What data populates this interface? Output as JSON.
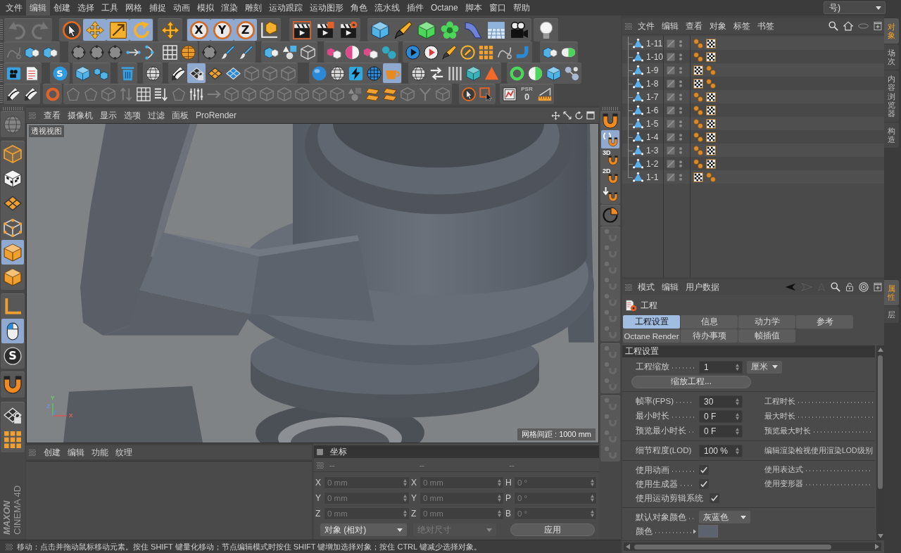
{
  "menu_bar": {
    "items": [
      {
        "label": "文件",
        "selected": false
      },
      {
        "label": "编辑",
        "selected": true
      },
      {
        "label": "创建",
        "selected": false
      },
      {
        "label": "选择",
        "selected": false
      },
      {
        "label": "工具",
        "selected": false
      },
      {
        "label": "网格",
        "selected": false
      },
      {
        "label": "捕捉",
        "selected": false
      },
      {
        "label": "动画",
        "selected": false
      },
      {
        "label": "模拟",
        "selected": false
      },
      {
        "label": "渲染",
        "selected": false
      },
      {
        "label": "雕刻",
        "selected": false
      },
      {
        "label": "运动跟踪",
        "selected": false
      },
      {
        "label": "运动图形",
        "selected": false
      },
      {
        "label": "角色",
        "selected": false
      },
      {
        "label": "流水线",
        "selected": false
      },
      {
        "label": "插件",
        "selected": false
      },
      {
        "label": "Octane",
        "selected": false
      },
      {
        "label": "脚本",
        "selected": false
      },
      {
        "label": "窗口",
        "selected": false
      },
      {
        "label": "帮助",
        "selected": false
      }
    ],
    "layout_dropdown": {
      "value": "号)"
    }
  },
  "toolbar": {
    "rows": [
      [
        {
          "buttons": [
            {
              "selected": false,
              "disabled": true
            },
            {
              "selected": false,
              "disabled": true
            }
          ]
        },
        {
          "buttons": [
            {
              "selected": false,
              "disabled": false
            },
            {
              "selected": true,
              "disabled": false
            },
            {
              "selected": true,
              "disabled": false
            },
            {
              "selected": true,
              "disabled": false
            }
          ]
        },
        {
          "buttons": [
            {
              "selected": false,
              "disabled": false
            }
          ]
        },
        {
          "buttons": [
            {
              "label": "X",
              "selected": true,
              "disabled": false
            },
            {
              "label": "Y",
              "selected": true,
              "disabled": false
            },
            {
              "label": "Z",
              "selected": true,
              "disabled": false
            },
            {
              "selected": false,
              "disabled": false
            }
          ]
        },
        {
          "buttons": [
            {
              "selected": false,
              "disabled": false
            },
            {
              "selected": false,
              "disabled": false
            },
            {
              "selected": false,
              "disabled": false
            }
          ]
        },
        {
          "buttons": [
            {
              "selected": false,
              "disabled": false
            },
            {
              "selected": false,
              "disabled": false
            },
            {
              "selected": false,
              "disabled": false
            },
            {
              "selected": false,
              "disabled": false
            },
            {
              "selected": false,
              "disabled": false
            },
            {
              "selected": false,
              "disabled": false
            },
            {
              "selected": false,
              "disabled": false
            }
          ]
        },
        {
          "buttons": [
            {
              "selected": false,
              "disabled": false
            }
          ]
        }
      ],
      [
        {
          "buttons": [
            {
              "selected": false,
              "disabled": true
            },
            {
              "selected": false,
              "disabled": false
            },
            {
              "selected": false,
              "disabled": false
            }
          ]
        },
        {
          "buttons": [
            {
              "selected": false,
              "disabled": false
            },
            {
              "selected": false,
              "disabled": false
            },
            {
              "selected": false,
              "disabled": false
            },
            {
              "selected": false,
              "disabled": false
            },
            {
              "selected": false,
              "disabled": false
            },
            {
              "selected": false,
              "disabled": false
            },
            {
              "selected": false,
              "disabled": false
            }
          ]
        },
        {
          "buttons": [
            {
              "selected": false,
              "disabled": false
            },
            {
              "selected": false,
              "disabled": false
            },
            {
              "selected": false,
              "disabled": false
            }
          ]
        },
        {
          "buttons": [
            {
              "selected": false,
              "disabled": false
            },
            {
              "selected": false,
              "disabled": false
            },
            {
              "selected": false,
              "disabled": false
            }
          ]
        },
        {
          "buttons": [
            {
              "selected": false,
              "disabled": false
            },
            {
              "selected": false,
              "disabled": false
            },
            {
              "selected": false,
              "disabled": false
            },
            {
              "selected": false,
              "disabled": false
            }
          ]
        },
        {
          "buttons": [
            {
              "selected": false,
              "disabled": false
            },
            {
              "selected": false,
              "disabled": false
            },
            {
              "selected": false,
              "disabled": false
            },
            {
              "selected": false,
              "disabled": false
            },
            {
              "selected": false,
              "disabled": false
            },
            {
              "selected": false,
              "disabled": false
            },
            {
              "selected": false,
              "disabled": false
            }
          ]
        },
        {
          "buttons": [
            {
              "selected": false,
              "disabled": false
            },
            {
              "selected": false,
              "disabled": false
            }
          ]
        }
      ],
      [
        {
          "buttons": [
            {
              "selected": false,
              "disabled": false
            },
            {
              "selected": false,
              "disabled": false
            }
          ]
        },
        {
          "buttons": [
            {
              "label": "S",
              "selected": false,
              "disabled": false
            }
          ]
        },
        {
          "buttons": [
            {
              "selected": false,
              "disabled": false
            },
            {
              "selected": false,
              "disabled": false
            }
          ]
        },
        {
          "buttons": [
            {
              "selected": false,
              "disabled": false
            }
          ]
        },
        {
          "buttons": [
            {
              "selected": false,
              "disabled": false
            }
          ]
        },
        {
          "buttons": [
            {
              "selected": false,
              "disabled": false
            },
            {
              "selected": true,
              "disabled": false
            },
            {
              "selected": false,
              "disabled": false
            },
            {
              "selected": false,
              "disabled": false
            },
            {
              "selected": false,
              "disabled": true
            },
            {
              "selected": false,
              "disabled": true
            },
            {
              "selected": false,
              "disabled": true
            }
          ]
        },
        {
          "buttons": [
            {
              "selected": false,
              "disabled": false
            },
            {
              "selected": false,
              "disabled": false
            },
            {
              "selected": false,
              "disabled": false
            },
            {
              "selected": false,
              "disabled": false
            },
            {
              "selected": true,
              "disabled": false
            }
          ]
        },
        {
          "buttons": [
            {
              "selected": false,
              "disabled": false
            },
            {
              "selected": false,
              "disabled": false
            },
            {
              "selected": false,
              "disabled": false
            },
            {
              "selected": false,
              "disabled": false
            },
            {
              "selected": false,
              "disabled": false
            }
          ]
        },
        {
          "buttons": [
            {
              "selected": false,
              "disabled": false
            },
            {
              "selected": false,
              "disabled": false
            },
            {
              "selected": false,
              "disabled": false
            },
            {
              "selected": false,
              "disabled": false
            }
          ]
        }
      ],
      [
        {
          "buttons": [
            {
              "selected": false,
              "disabled": false
            },
            {
              "selected": false,
              "disabled": false
            }
          ]
        },
        {
          "buttons": [
            {
              "selected": false,
              "disabled": false
            }
          ]
        },
        {
          "buttons": [
            {
              "selected": false,
              "disabled": true
            },
            {
              "selected": false,
              "disabled": true
            },
            {
              "selected": false,
              "disabled": true
            },
            {
              "selected": false,
              "disabled": true
            },
            {
              "selected": false,
              "disabled": false
            },
            {
              "selected": false,
              "disabled": false
            },
            {
              "selected": false,
              "disabled": true
            },
            {
              "selected": false,
              "disabled": false
            },
            {
              "selected": false,
              "disabled": true
            },
            {
              "selected": false,
              "disabled": true
            },
            {
              "selected": false,
              "disabled": true
            },
            {
              "selected": false,
              "disabled": true
            },
            {
              "selected": false,
              "disabled": true
            },
            {
              "selected": false,
              "disabled": true
            },
            {
              "selected": false,
              "disabled": true
            },
            {
              "selected": false,
              "disabled": true
            },
            {
              "selected": false,
              "disabled": true
            },
            {
              "selected": false,
              "disabled": false
            },
            {
              "selected": false,
              "disabled": false
            },
            {
              "selected": false,
              "disabled": true
            },
            {
              "selected": false,
              "disabled": true
            },
            {
              "selected": false,
              "disabled": true
            }
          ]
        },
        {
          "buttons": [
            {
              "selected": false,
              "disabled": false
            },
            {
              "selected": false,
              "disabled": false
            }
          ]
        },
        {
          "buttons": [
            {
              "selected": false,
              "disabled": false
            },
            {
              "label": "PSR",
              "value": "0",
              "selected": false,
              "disabled": false
            },
            {
              "selected": false,
              "disabled": false
            }
          ]
        }
      ]
    ]
  },
  "left_toolbar": {
    "groups": [
      {
        "buttons": [
          {
            "selected": false,
            "disabled": true
          }
        ]
      },
      {
        "buttons": [
          {
            "selected": false,
            "disabled": false
          },
          {
            "selected": false,
            "disabled": false
          },
          {
            "selected": false,
            "disabled": false
          },
          {
            "selected": false,
            "disabled": false
          },
          {
            "selected": true,
            "disabled": false
          },
          {
            "selected": false,
            "disabled": false
          }
        ]
      },
      {
        "buttons": [
          {
            "selected": false,
            "disabled": false
          },
          {
            "selected": true,
            "disabled": false
          },
          {
            "label": "S",
            "selected": false,
            "disabled": false
          }
        ]
      },
      {
        "buttons": [
          {
            "selected": false,
            "disabled": false
          }
        ]
      },
      {
        "buttons": [
          {
            "selected": false,
            "disabled": false
          },
          {
            "selected": false,
            "disabled": false
          }
        ]
      }
    ]
  },
  "logo": {
    "lines": [
      "MAXON",
      "CINEMA 4D"
    ]
  },
  "viewport": {
    "menu": [
      "查看",
      "摄像机",
      "显示",
      "选项",
      "过滤",
      "面板",
      "ProRender"
    ],
    "view_name": "透视视图",
    "grid_spacing": "网格间距 : 1000 mm",
    "axis_labels": [
      "Y",
      "Z",
      "X"
    ]
  },
  "snap_toolbar": {
    "groups": [
      {
        "buttons": [
          {
            "selected": false,
            "disabled": false
          },
          {
            "selected": true,
            "disabled": false
          },
          {
            "label": "3D",
            "selected": false,
            "disabled": false
          },
          {
            "label": "2D",
            "selected": false,
            "disabled": false
          },
          {
            "selected": false,
            "disabled": false
          }
        ]
      },
      {
        "buttons": [
          {
            "selected": false,
            "disabled": false
          }
        ]
      },
      {
        "buttons": [
          {
            "selected": false,
            "disabled": true
          },
          {
            "selected": false,
            "disabled": true
          },
          {
            "selected": false,
            "disabled": true
          },
          {
            "selected": false,
            "disabled": true
          },
          {
            "selected": false,
            "disabled": true
          },
          {
            "selected": false,
            "disabled": true
          },
          {
            "selected": false,
            "disabled": true
          }
        ]
      },
      {
        "buttons": [
          {
            "selected": false,
            "disabled": true
          },
          {
            "selected": false,
            "disabled": true
          },
          {
            "selected": false,
            "disabled": true
          }
        ]
      },
      {
        "buttons": [
          {
            "selected": false,
            "disabled": true
          },
          {
            "selected": false,
            "disabled": true
          },
          {
            "selected": false,
            "disabled": true
          },
          {
            "selected": false,
            "disabled": true
          }
        ]
      }
    ]
  },
  "material_manager": {
    "menu": [
      "创建",
      "编辑",
      "功能",
      "纹理"
    ]
  },
  "coordinates": {
    "title": "坐标",
    "column_heads": [
      "--",
      "--",
      "--"
    ],
    "rows": [
      {
        "fields": [
          {
            "label": "X",
            "value": "0 mm",
            "disabled": true
          },
          {
            "label": "X",
            "value": "0 mm",
            "disabled": true
          },
          {
            "label": "H",
            "value": "0 °",
            "disabled": true
          }
        ]
      },
      {
        "fields": [
          {
            "label": "Y",
            "value": "0 mm",
            "disabled": true
          },
          {
            "label": "Y",
            "value": "0 mm",
            "disabled": true
          },
          {
            "label": "P",
            "value": "0 °",
            "disabled": true
          }
        ]
      },
      {
        "fields": [
          {
            "label": "Z",
            "value": "0 mm",
            "disabled": true
          },
          {
            "label": "Z",
            "value": "0 mm",
            "disabled": true
          },
          {
            "label": "B",
            "value": "0 °",
            "disabled": true
          }
        ]
      }
    ],
    "mode_dropdown": {
      "value": "对象 (相对)",
      "disabled": false
    },
    "size_dropdown": {
      "value": "绝对尺寸",
      "disabled": true
    },
    "apply_button": "应用"
  },
  "status_bar": {
    "text": "移动：点击并拖动鼠标移动元素。按住 SHIFT 键量化移动；节点编辑模式时按住 SHIFT 键增加选择对象；按住 CTRL 键减少选择对象。"
  },
  "object_manager": {
    "menu": [
      "文件",
      "编辑",
      "查看",
      "对象",
      "标签",
      "书签"
    ],
    "objects": [
      {
        "name": "1-11",
        "selected": false,
        "tags": [
          {
            "kind": "balls"
          },
          {
            "kind": "checker"
          }
        ]
      },
      {
        "name": "1-10",
        "selected": false,
        "tags": [
          {
            "kind": "balls"
          },
          {
            "kind": "checker"
          }
        ]
      },
      {
        "name": "1-9",
        "selected": false,
        "tags": [
          {
            "kind": "checker"
          },
          {
            "kind": "balls"
          }
        ]
      },
      {
        "name": "1-8",
        "selected": false,
        "tags": [
          {
            "kind": "checker"
          },
          {
            "kind": "balls"
          }
        ]
      },
      {
        "name": "1-7",
        "selected": false,
        "tags": [
          {
            "kind": "balls"
          },
          {
            "kind": "checker"
          }
        ]
      },
      {
        "name": "1-6",
        "selected": false,
        "tags": [
          {
            "kind": "balls"
          },
          {
            "kind": "checker"
          }
        ]
      },
      {
        "name": "1-5",
        "selected": false,
        "tags": [
          {
            "kind": "balls"
          },
          {
            "kind": "checker"
          }
        ]
      },
      {
        "name": "1-4",
        "selected": false,
        "tags": [
          {
            "kind": "balls"
          },
          {
            "kind": "checker"
          }
        ]
      },
      {
        "name": "1-3",
        "selected": false,
        "tags": [
          {
            "kind": "balls"
          },
          {
            "kind": "checker"
          }
        ]
      },
      {
        "name": "1-2",
        "selected": false,
        "tags": [
          {
            "kind": "balls"
          },
          {
            "kind": "checker"
          }
        ]
      },
      {
        "name": "1-1",
        "selected": false,
        "tags": [
          {
            "kind": "checker"
          },
          {
            "kind": "balls"
          }
        ]
      }
    ]
  },
  "attribute_manager": {
    "menu": [
      "模式",
      "编辑",
      "用户数据"
    ],
    "title": "工程",
    "tabs": [
      [
        {
          "label": "工程设置",
          "selected": true
        },
        {
          "label": "信息",
          "selected": false
        },
        {
          "label": "动力学",
          "selected": false
        },
        {
          "label": "参考",
          "selected": false
        }
      ],
      [
        {
          "label": "Octane Render",
          "selected": false
        },
        {
          "label": "待办事项",
          "selected": false
        },
        {
          "label": "帧插值",
          "selected": false
        }
      ]
    ],
    "section": "工程设置",
    "groups": [
      {
        "rows": [
          {
            "kind": "number",
            "label": "工程缩放",
            "value": "1",
            "unit": "厘米"
          },
          {
            "kind": "button",
            "label": "缩放工程..."
          }
        ]
      },
      {
        "rows": [
          {
            "kind": "number",
            "label": "帧率(FPS)",
            "value": "30",
            "right_label": "工程时长"
          },
          {
            "kind": "number",
            "label": "最小时长",
            "value": "0 F",
            "right_label": "最大时长"
          },
          {
            "kind": "number",
            "label": "预览最小时长",
            "value": "0 F",
            "right_label": "预览最大时长"
          }
        ]
      },
      {
        "rows": [
          {
            "kind": "number",
            "label": "细节程度(LOD)",
            "value": "100 %",
            "right_label": "编辑渲染检视使用渲染LOD级别"
          }
        ]
      },
      {
        "rows": [
          {
            "kind": "checkbox",
            "label": "使用动画",
            "checked": true,
            "right_label": "使用表达式"
          },
          {
            "kind": "checkbox",
            "label": "使用生成器",
            "checked": true,
            "right_label": "使用变形器"
          },
          {
            "kind": "checkbox",
            "label": "使用运动剪辑系统",
            "checked": true
          }
        ]
      },
      {
        "rows": [
          {
            "kind": "dropdown",
            "label": "默认对象颜色",
            "value": "灰蓝色"
          },
          {
            "kind": "color",
            "label": "颜色",
            "color": "#5c636e"
          }
        ]
      }
    ]
  },
  "side_tabs": {
    "top": [
      {
        "label": "对象",
        "selected": true
      },
      {
        "label": "场次",
        "selected": false
      },
      {
        "label": "内容浏览器",
        "selected": false
      },
      {
        "label": "构造",
        "selected": false
      }
    ],
    "bottom": [
      {
        "label": "属性",
        "selected": true
      },
      {
        "label": "层",
        "selected": false
      }
    ]
  }
}
